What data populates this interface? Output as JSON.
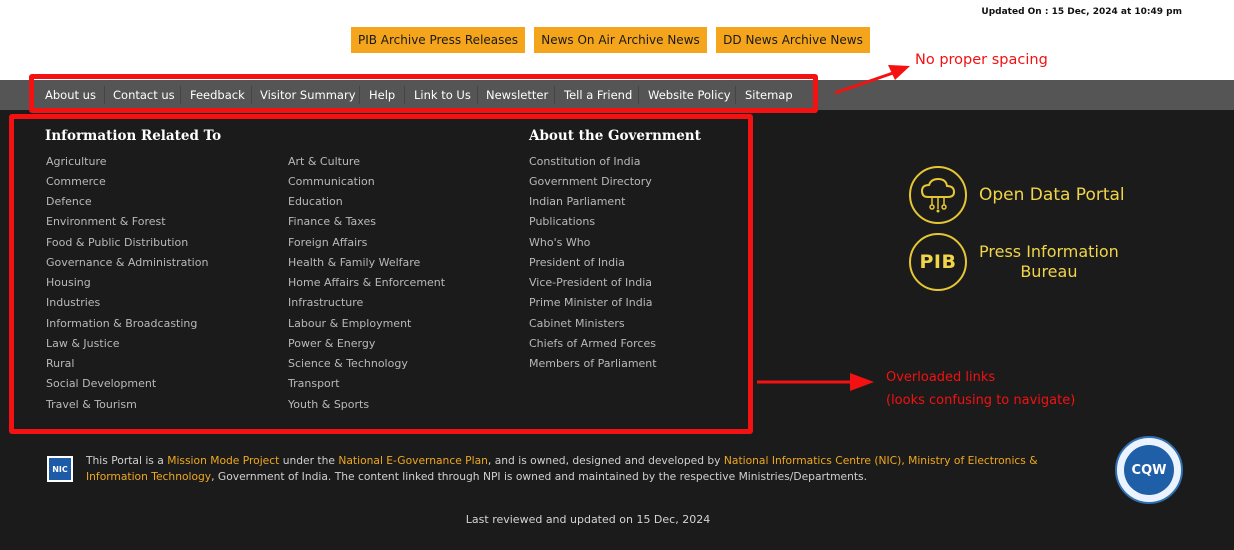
{
  "header": {
    "updated": "Updated On : 15 Dec, 2024 at 10:49 pm",
    "archive_buttons": [
      "PIB Archive Press Releases",
      "News On Air Archive News",
      "DD News Archive News"
    ]
  },
  "nav": {
    "items": [
      "About us",
      "Contact us",
      "Feedback",
      "Visitor Summary",
      "Help",
      "Link to Us",
      "Newsletter",
      "Tell a Friend",
      "Website Policy",
      "Sitemap"
    ]
  },
  "info": {
    "heading": "Information Related To",
    "col1": [
      "Agriculture",
      "Commerce",
      "Defence",
      "Environment & Forest",
      "Food & Public Distribution",
      "Governance & Administration",
      "Housing",
      "Industries",
      "Information & Broadcasting",
      "Law & Justice",
      "Rural",
      "Social Development",
      "Travel & Tourism"
    ],
    "col2": [
      "Art & Culture",
      "Communication",
      "Education",
      "Finance & Taxes",
      "Foreign Affairs",
      "Health & Family Welfare",
      "Home Affairs & Enforcement",
      "Infrastructure",
      "Labour & Employment",
      "Power & Energy",
      "Science & Technology",
      "Transport",
      "Youth & Sports"
    ]
  },
  "gov": {
    "heading": "About the Government",
    "items": [
      "Constitution of India",
      "Government Directory",
      "Indian Parliament",
      "Publications",
      "Who's Who",
      "President of India",
      "Vice-President of India",
      "Prime Minister of India",
      "Cabinet Ministers",
      "Chiefs of Armed Forces",
      "Members of Parliament"
    ]
  },
  "external": {
    "odp_label": "Open Data Portal",
    "pib_badge": "PIB",
    "pib_line1": "Press Information",
    "pib_line2": "Bureau"
  },
  "annotations": {
    "spacing": "No proper spacing",
    "overload_line1": "Overloaded links",
    "overload_line2": "(looks confusing to navigate)"
  },
  "footer": {
    "nic_logo": "NIC",
    "portal_t1": "This Portal is a ",
    "portal_l1": "Mission Mode Project",
    "portal_t2": " under the ",
    "portal_l2": "National E-Governance Plan",
    "portal_t3": ", and is owned, designed and developed by ",
    "portal_l3": "National Informatics Centre (NIC), Ministry of Electronics & Information Technology",
    "portal_t4": ", Government of India. The content linked through NPI is owned and maintained by the respective Ministries/Departments.",
    "cqw": "CQW",
    "last_reviewed": "Last reviewed and updated on 15 Dec, 2024"
  },
  "colors": {
    "accent": "#f5a51b",
    "highlight": "#f0a81d",
    "annotation": "#f41111",
    "background": "#1b1b1b",
    "nav_bg": "#555555"
  }
}
